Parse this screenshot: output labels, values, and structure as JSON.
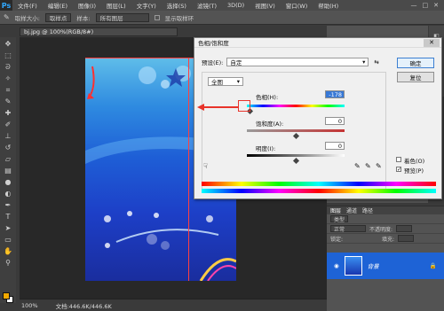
{
  "menubar": {
    "logo": "Ps",
    "items": [
      "文件(F)",
      "编辑(E)",
      "图像(I)",
      "图层(L)",
      "文字(Y)",
      "选择(S)",
      "滤镜(T)",
      "3D(D)",
      "视图(V)",
      "窗口(W)",
      "帮助(H)"
    ],
    "window_controls": [
      "—",
      "□",
      "✕"
    ]
  },
  "optbar": {
    "sample_label": "取样大小:",
    "sample_value": "取样点",
    "sample_layer_label": "样本:",
    "sample_layer_value": "所有图层",
    "ring_label": "显示取样环"
  },
  "document": {
    "tab_label": "bj.jpg @ 100%(RGB/8#)",
    "zoom": "100%",
    "doc_size": "文档:446.6K/446.6K"
  },
  "dialog": {
    "title": "色相/饱和度",
    "preset_label": "预设(E):",
    "preset_value": "自定",
    "ok_label": "确定",
    "reset_label": "复位",
    "channel_value": "全图",
    "hue_label": "色相(H):",
    "hue_value": "-178",
    "sat_label": "饱和度(A):",
    "sat_value": "0",
    "light_label": "明度(I):",
    "light_value": "0",
    "colorize_label": "着色(O)",
    "colorize_checked": false,
    "preview_label": "预览(P)",
    "preview_checked": true
  },
  "layers": {
    "tabs": [
      "图层",
      "通道",
      "路径"
    ],
    "kind_label": "类型",
    "blend_mode": "正常",
    "opacity_label": "不透明度:",
    "lock_label": "锁定:",
    "fill_label": "填充:",
    "layer_name": "背景"
  },
  "colors": {
    "accent": "#3778d6",
    "highlight": "#e8332a",
    "foreground_swatch": "#f2a900"
  }
}
